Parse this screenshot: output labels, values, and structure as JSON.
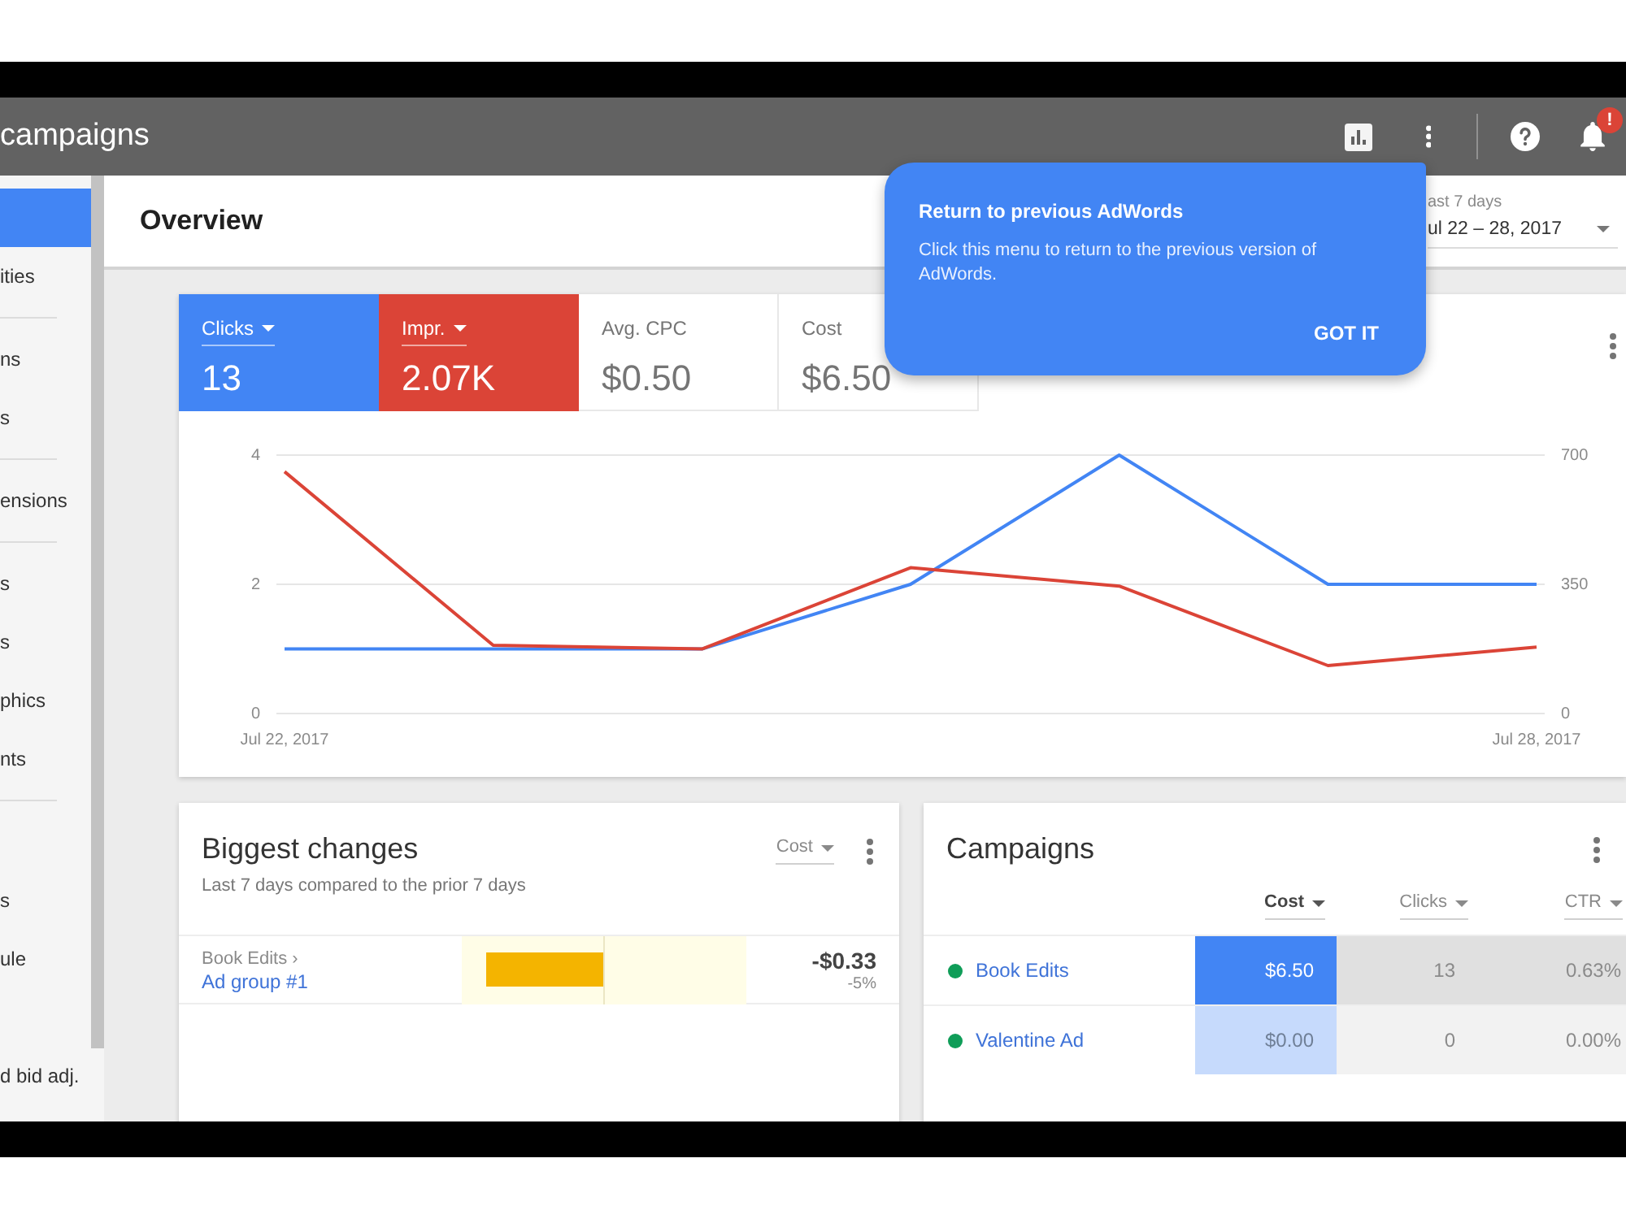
{
  "header": {
    "title": "campaigns",
    "badge": "!"
  },
  "sidebar": {
    "sections": [
      {
        "items": [
          {
            "selected": true
          },
          {
            "label": "ities",
            "selected": false
          }
        ]
      },
      {
        "items": [
          {
            "label": "ns",
            "selected": false
          },
          {
            "label": "s",
            "selected": false
          }
        ]
      },
      {
        "items": [
          {
            "label": "ensions",
            "selected": false
          }
        ]
      },
      {
        "items": [
          {
            "label": "s",
            "selected": false
          },
          {
            "label": "s",
            "selected": false
          },
          {
            "label": "phics",
            "selected": false
          },
          {
            "label": "nts",
            "selected": false
          }
        ]
      },
      {
        "items": [
          {
            "label": "s",
            "selected": false
          },
          {
            "label": "ule",
            "selected": false
          },
          {
            "label": "d bid adj.",
            "selected": false
          }
        ]
      }
    ]
  },
  "overview": {
    "title": "Overview",
    "date_label": "ast 7 days",
    "date_range": "ul 22 – 28, 2017"
  },
  "tooltip": {
    "title": "Return to previous AdWords",
    "body": "Click this menu to return to the previous version of AdWords.",
    "button": "GOT IT"
  },
  "performance": {
    "metrics": [
      {
        "label": "Clicks",
        "value": "13",
        "selected": true,
        "color": "#4285f4"
      },
      {
        "label": "Impr.",
        "value": "2.07K",
        "selected": true,
        "color": "#db4437"
      },
      {
        "label": "Avg. CPC",
        "value": "$0.50",
        "selected": false
      },
      {
        "label": "Cost",
        "value": "$6.50",
        "selected": false
      }
    ],
    "chart_data": {
      "type": "line",
      "categories": [
        "Jul 22, 2017",
        null,
        null,
        null,
        null,
        null,
        "Jul 28, 2017"
      ],
      "series": [
        {
          "color": "#4285f4",
          "values": [
            1,
            1,
            1,
            2,
            4,
            2,
            2
          ]
        },
        {
          "color": "#db4437",
          "axis": "y2",
          "values": [
            655,
            185,
            175,
            395,
            345,
            130,
            180
          ]
        }
      ],
      "ylim": [
        0,
        4
      ],
      "yticks": [
        0,
        2,
        4
      ],
      "y2lim": [
        0,
        700
      ],
      "y2ticks": [
        0,
        350,
        700
      ],
      "grid": true
    }
  },
  "changes": {
    "title": "Biggest changes",
    "subtitle": "Last 7 days compared to the prior 7 days",
    "metric": "Cost",
    "rows": [
      {
        "parent": "Book Edits ›",
        "name": "Ad group #1",
        "value": "-$0.33",
        "percent": "-5%"
      }
    ]
  },
  "campaigns": {
    "title": "Campaigns",
    "columns": [
      {
        "label": "Cost",
        "selected": true
      },
      {
        "label": "Clicks",
        "selected": false
      },
      {
        "label": "CTR",
        "selected": false
      }
    ],
    "rows": [
      {
        "name": "Book Edits",
        "color": "#0f9d58",
        "selected": true,
        "cells": [
          "$6.50",
          "13",
          "0.63%"
        ]
      },
      {
        "name": "Valentine Ad",
        "color": "#0f9d58",
        "selected": false,
        "cells": [
          "$0.00",
          "0",
          "0.00%"
        ]
      }
    ]
  }
}
